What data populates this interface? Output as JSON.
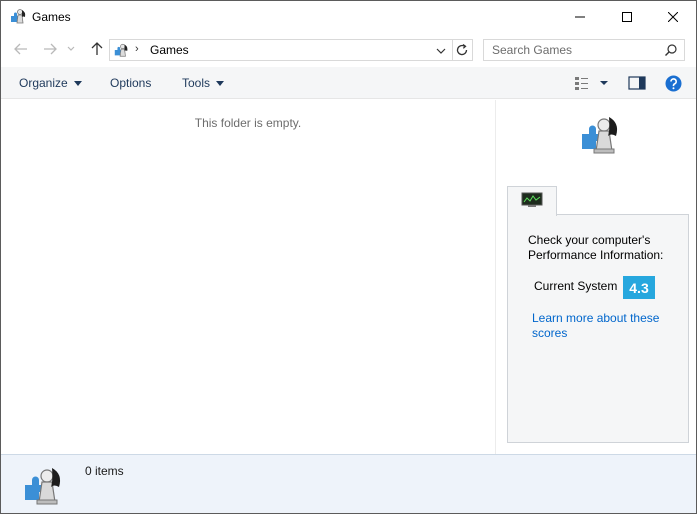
{
  "window": {
    "title": "Games",
    "controls": [
      "minimize-icon",
      "maximize-icon",
      "close-icon"
    ]
  },
  "navigation": {
    "location": "Games",
    "separator": "›",
    "search_placeholder": "Search Games"
  },
  "commandbar": {
    "organize_label": "Organize",
    "options_label": "Options",
    "tools_label": "Tools"
  },
  "content": {
    "empty_message": "This folder is empty."
  },
  "performance": {
    "heading": "Check your computer's Performance Information:",
    "row_label": "Current System",
    "score": "4.3",
    "link_text": "Learn more about these scores",
    "score_color": "#26a7de",
    "link_color": "#0066cc"
  },
  "details": {
    "item_count": "0 items"
  },
  "icons": [
    "games-chess-icon",
    "back-arrow-icon",
    "forward-arrow-icon",
    "recent-chevron-icon",
    "up-arrow-icon",
    "refresh-icon",
    "search-icon",
    "view-options-icon",
    "preview-pane-icon",
    "help-icon",
    "monitor-icon"
  ]
}
